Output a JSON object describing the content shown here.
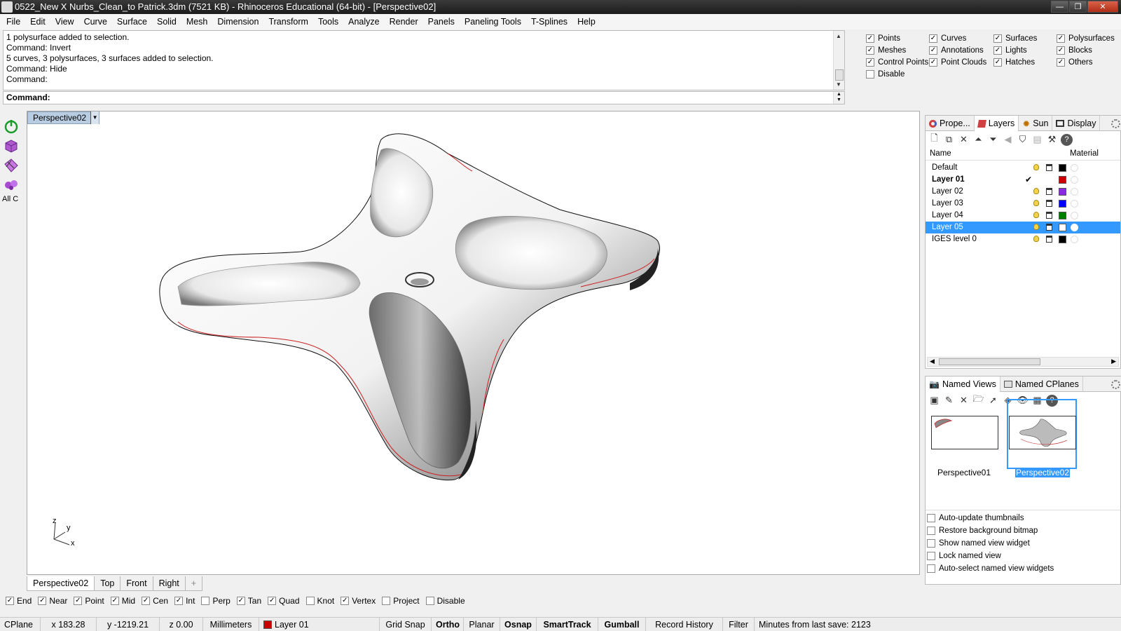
{
  "window": {
    "title": "0522_New X Nurbs_Clean_to Patrick.3dm (7521 KB) - Rhinoceros Educational (64-bit) - [Perspective02]",
    "buttons": [
      "—",
      "❐",
      "✕"
    ]
  },
  "menu": [
    "File",
    "Edit",
    "View",
    "Curve",
    "Surface",
    "Solid",
    "Mesh",
    "Dimension",
    "Transform",
    "Tools",
    "Analyze",
    "Render",
    "Panels",
    "Paneling Tools",
    "T-Splines",
    "Help"
  ],
  "history": [
    "1 polysurface added to selection.",
    "Command: Invert",
    "5 curves, 3 polysurfaces, 3 surfaces added to selection.",
    "Command: Hide",
    "Command:"
  ],
  "command_prompt": "Command:",
  "visibility_filter": [
    {
      "label": "Points",
      "checked": true
    },
    {
      "label": "Curves",
      "checked": true
    },
    {
      "label": "Surfaces",
      "checked": true
    },
    {
      "label": "Polysurfaces",
      "checked": true
    },
    {
      "label": "Meshes",
      "checked": true
    },
    {
      "label": "Annotations",
      "checked": true
    },
    {
      "label": "Lights",
      "checked": true
    },
    {
      "label": "Blocks",
      "checked": true
    },
    {
      "label": "Control Points",
      "checked": true
    },
    {
      "label": "Point Clouds",
      "checked": true
    },
    {
      "label": "Hatches",
      "checked": true
    },
    {
      "label": "Others",
      "checked": true
    },
    {
      "label": "Disable",
      "checked": false
    }
  ],
  "left_toolbar": {
    "all_commands_label": "All C"
  },
  "viewport": {
    "title": "Perspective02",
    "axis_labels": {
      "z": "z",
      "y": "y",
      "x": "x"
    }
  },
  "viewport_tabs": [
    "Perspective02",
    "Top",
    "Front",
    "Right",
    "+"
  ],
  "osnaps": [
    {
      "label": "End",
      "checked": true
    },
    {
      "label": "Near",
      "checked": true
    },
    {
      "label": "Point",
      "checked": true
    },
    {
      "label": "Mid",
      "checked": true
    },
    {
      "label": "Cen",
      "checked": true
    },
    {
      "label": "Int",
      "checked": true
    },
    {
      "label": "Perp",
      "checked": false
    },
    {
      "label": "Tan",
      "checked": true
    },
    {
      "label": "Quad",
      "checked": true
    },
    {
      "label": "Knot",
      "checked": false
    },
    {
      "label": "Vertex",
      "checked": true
    },
    {
      "label": "Project",
      "checked": false
    },
    {
      "label": "Disable",
      "checked": false
    }
  ],
  "status": {
    "cplane": "CPlane",
    "x": "x 183.28",
    "y": "y -1219.21",
    "z": "z 0.00",
    "units": "Millimeters",
    "layer": "Layer 01",
    "layer_color": "#cc0000",
    "grid_snap": "Grid Snap",
    "ortho": "Ortho",
    "planar": "Planar",
    "osnap": "Osnap",
    "smarttrack": "SmartTrack",
    "gumball": "Gumball",
    "record_history": "Record History",
    "filter": "Filter",
    "minutes": "Minutes from last save: 2123"
  },
  "layers_panel": {
    "tabs": [
      "Prope...",
      "Layers",
      "Sun",
      "Display"
    ],
    "columns": {
      "name": "Name",
      "material": "Material"
    },
    "layers": [
      {
        "name": "Default",
        "color": "#000000",
        "current": false,
        "selected": false
      },
      {
        "name": "Layer 01",
        "color": "#cc0000",
        "current": true,
        "selected": false
      },
      {
        "name": "Layer 02",
        "color": "#8a2be2",
        "current": false,
        "selected": false
      },
      {
        "name": "Layer 03",
        "color": "#0000ff",
        "current": false,
        "selected": false
      },
      {
        "name": "Layer 04",
        "color": "#008000",
        "current": false,
        "selected": false
      },
      {
        "name": "Layer 05",
        "color": "#ffffff",
        "current": false,
        "selected": true
      },
      {
        "name": "IGES level 0",
        "color": "#000000",
        "current": false,
        "selected": false
      }
    ]
  },
  "named_views_panel": {
    "tabs": [
      "Named Views",
      "Named CPlanes"
    ],
    "views": [
      "Perspective01",
      "Perspective02"
    ],
    "options": [
      {
        "label": "Auto-update thumbnails",
        "checked": false
      },
      {
        "label": "Restore background bitmap",
        "checked": false
      },
      {
        "label": "Show named view widget",
        "checked": false
      },
      {
        "label": "Lock named view",
        "checked": false
      },
      {
        "label": "Auto-select named view widgets",
        "checked": false
      }
    ]
  }
}
